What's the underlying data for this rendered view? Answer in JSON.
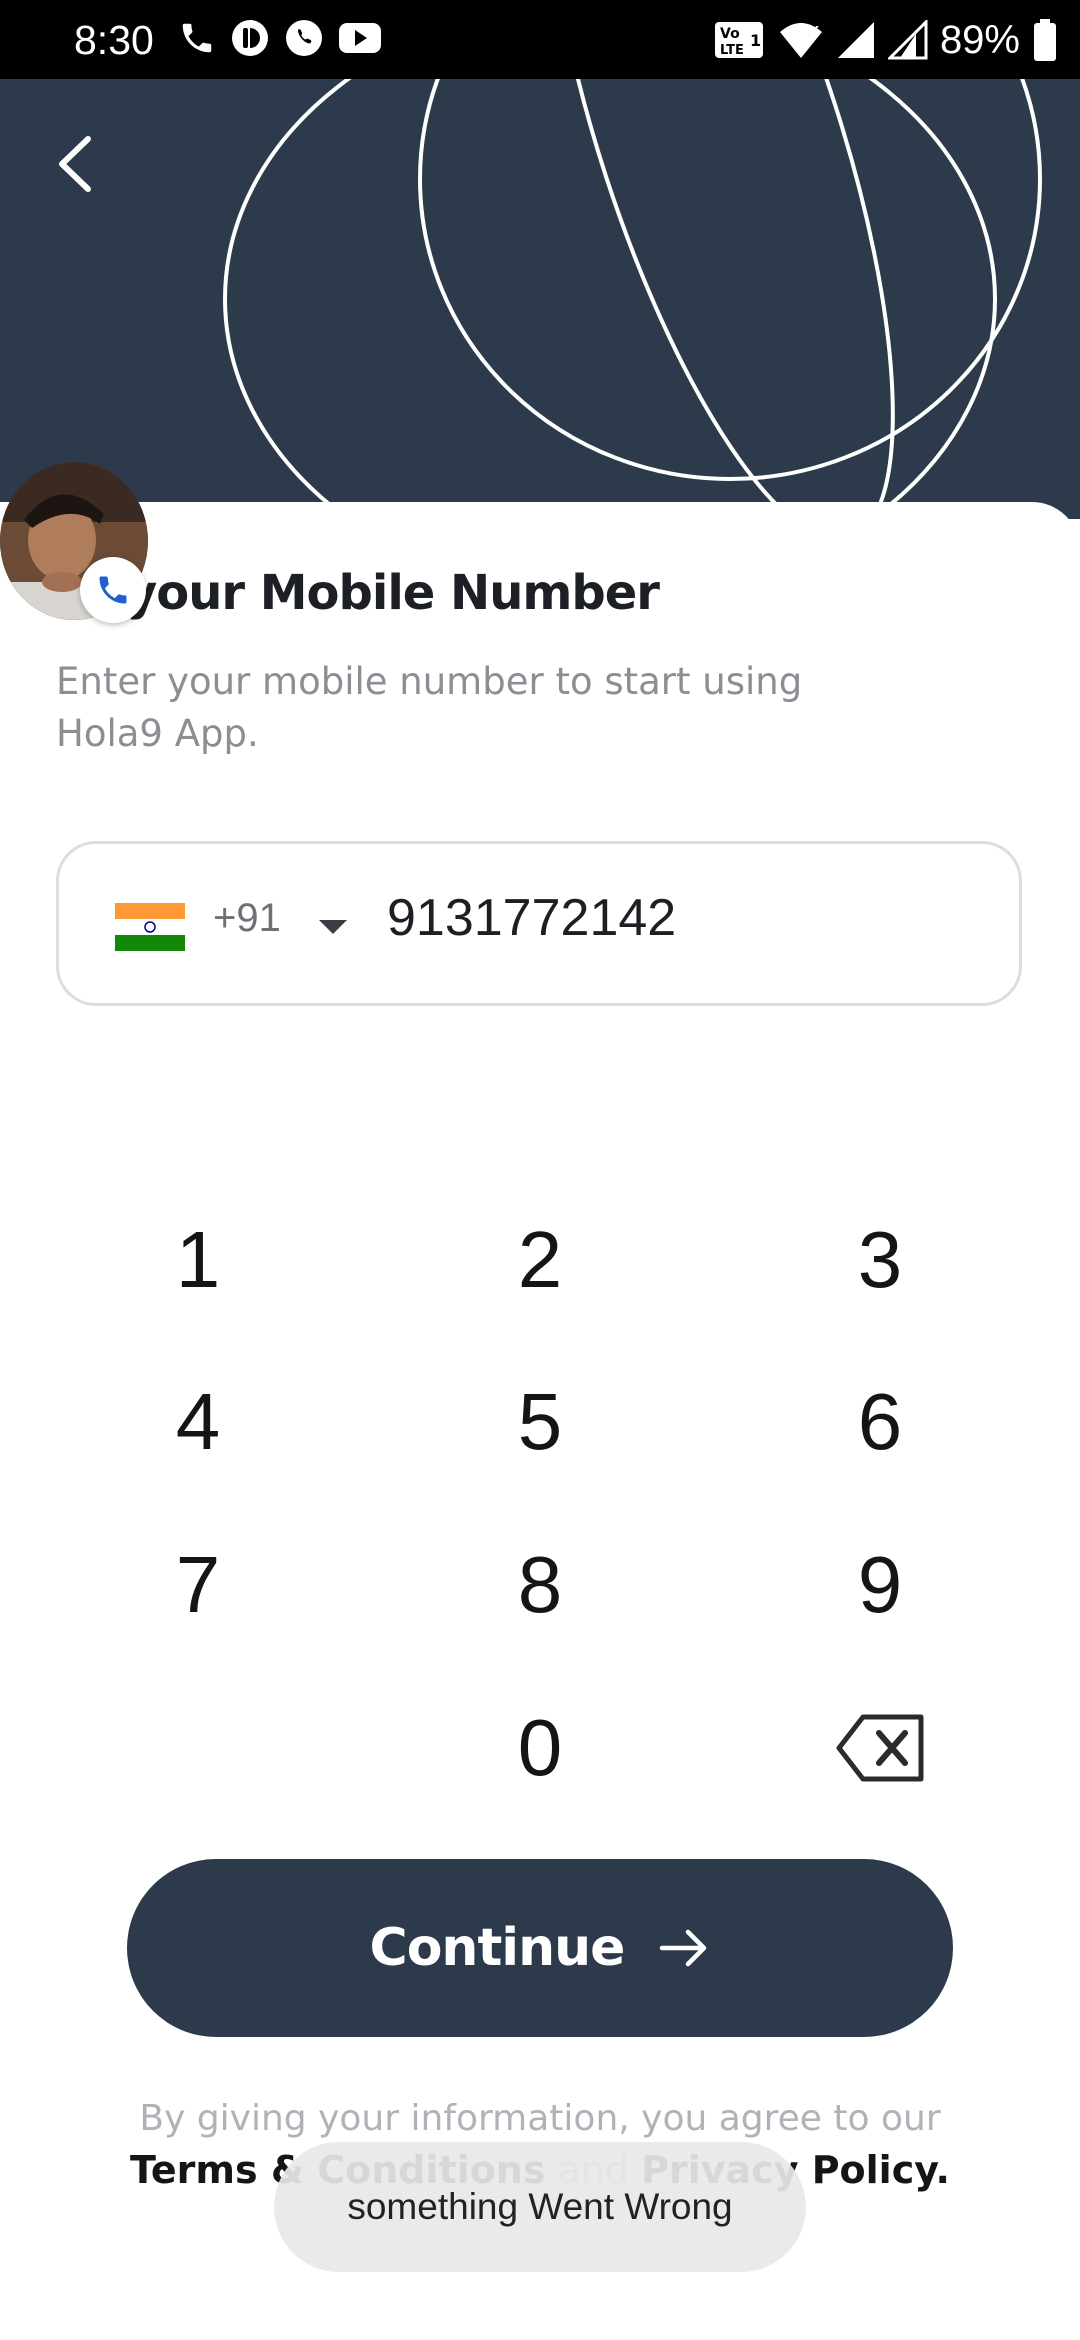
{
  "status_bar": {
    "time": "8:30",
    "battery": "89%",
    "left_icons": [
      "phone-icon",
      "app-notification-icon",
      "whatsapp-icon",
      "youtube-icon"
    ],
    "right_icons": [
      "volte-icon",
      "wifi-icon",
      "signal-icon",
      "battery-icon"
    ]
  },
  "header": {
    "background": "#2c3a4b",
    "back_icon": "chevron-left-icon"
  },
  "screen": {
    "title": "er your Mobile Number",
    "subtitle": "Enter your mobile number to start using Hola9 App."
  },
  "phone_input": {
    "country_flag": "india-flag-icon",
    "country_code": "+91",
    "value": "9131772142"
  },
  "keypad": {
    "keys": [
      "1",
      "2",
      "3",
      "4",
      "5",
      "6",
      "7",
      "8",
      "9",
      "0"
    ],
    "backspace_icon": "backspace-icon"
  },
  "continue_button": {
    "label": "Continue",
    "icon": "arrow-right-icon",
    "color": "#2c3a4b"
  },
  "legal": {
    "agree_text": "By giving your information, you agree to our",
    "terms": "Terms & Conditions",
    "and": " and ",
    "privacy": "Privacy Policy."
  },
  "toast": {
    "message": "something Went Wrong"
  }
}
